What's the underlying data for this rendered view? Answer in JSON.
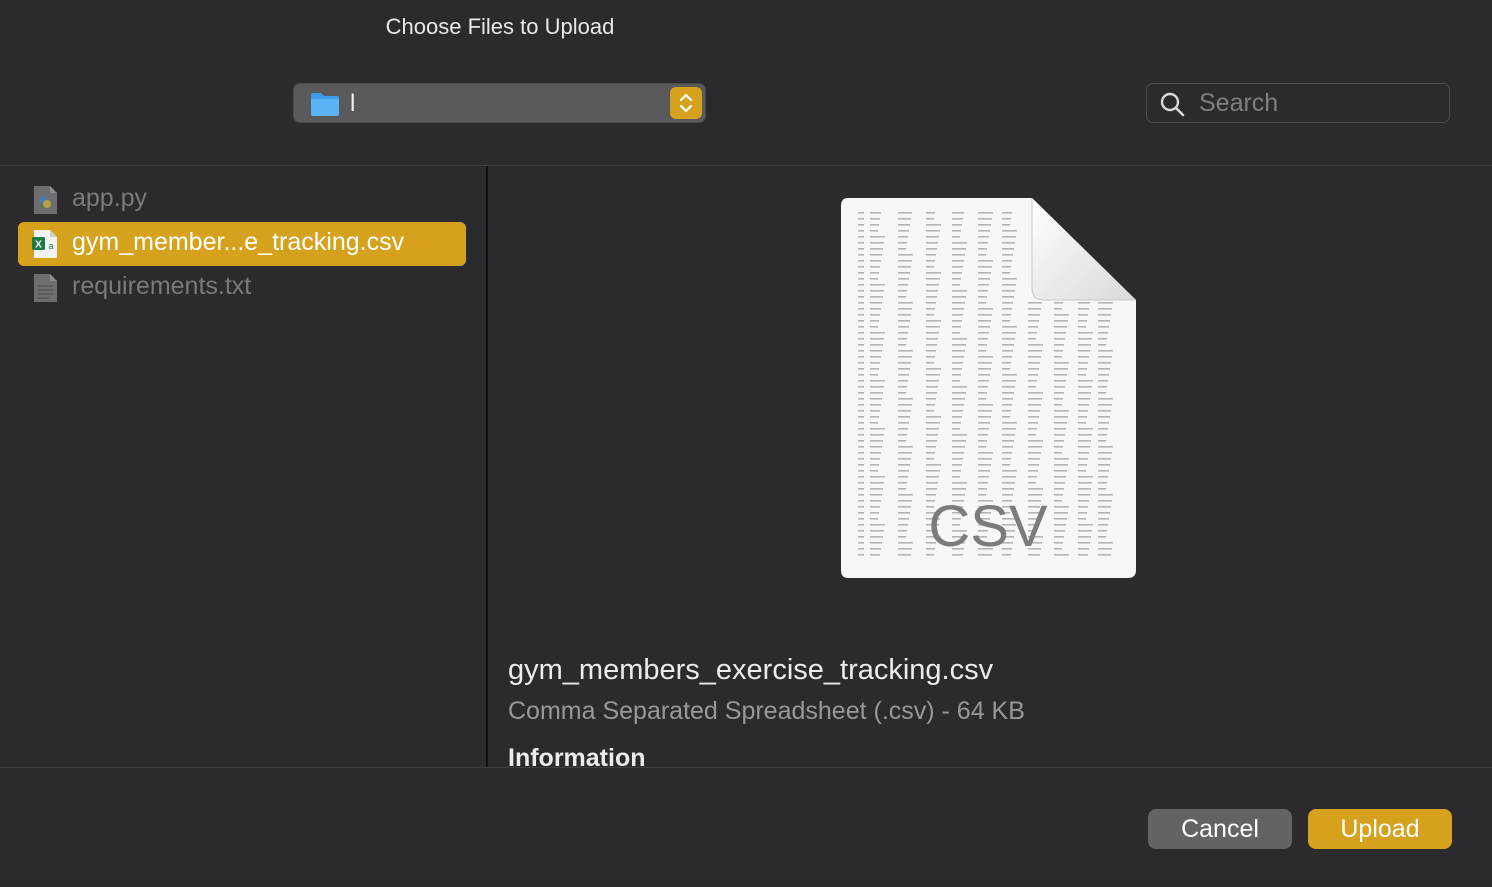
{
  "dialog": {
    "title": "Choose Files to Upload"
  },
  "location": {
    "current_folder": "l"
  },
  "search": {
    "placeholder": "Search",
    "value": ""
  },
  "files": [
    {
      "name": "app.py",
      "icon": "python-file-icon",
      "state": "dimmed"
    },
    {
      "name": "gym_member...e_tracking.csv",
      "icon": "excel-csv-file-icon",
      "state": "selected"
    },
    {
      "name": "requirements.txt",
      "icon": "text-file-icon",
      "state": "dimmed"
    }
  ],
  "preview": {
    "thumbnail_badge": "CSV",
    "file_name": "gym_members_exercise_tracking.csv",
    "kind_and_size": "Comma Separated Spreadsheet (.csv) - 64 KB",
    "section_heading": "Information"
  },
  "buttons": {
    "cancel": "Cancel",
    "upload": "Upload"
  },
  "colors": {
    "accent": "#d6a21e",
    "background": "#2b2b2d",
    "selection": "#d6a21e"
  }
}
